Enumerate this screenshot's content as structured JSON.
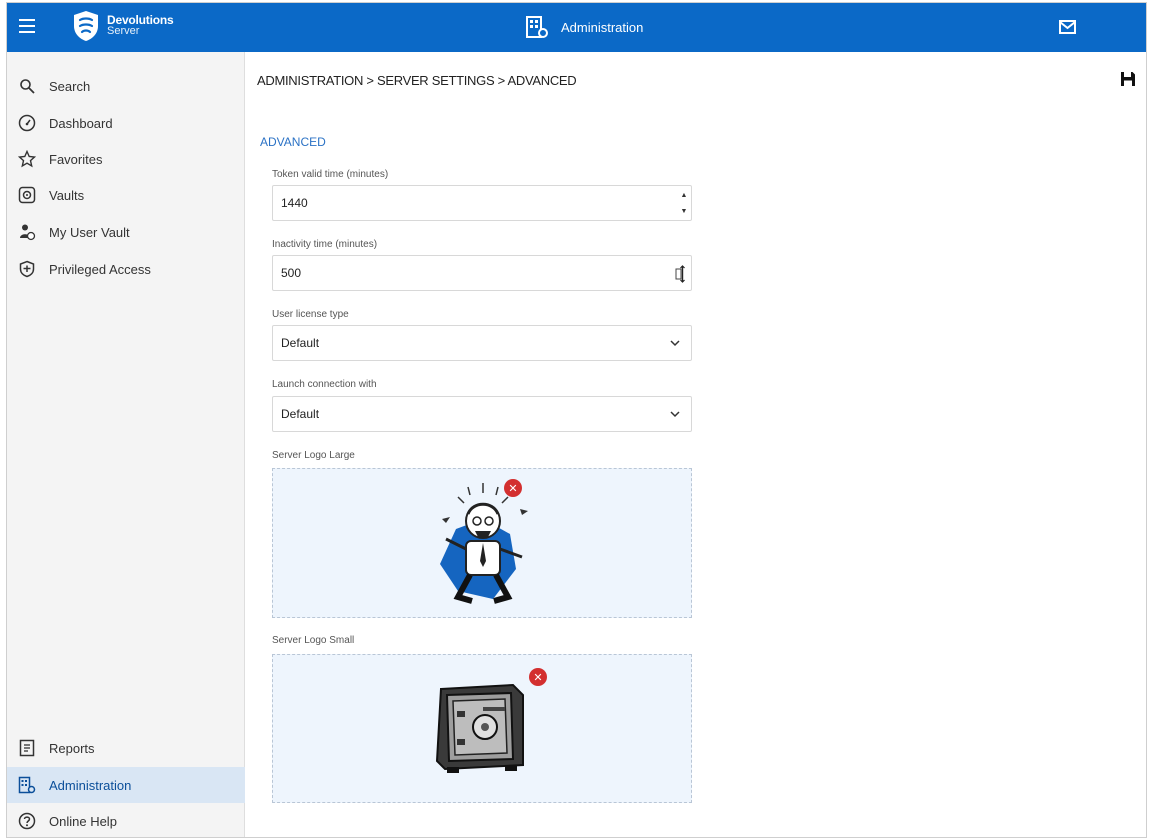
{
  "app": {
    "brand": "Devolutions",
    "product": "Server",
    "title": "Administration"
  },
  "sidebar": {
    "top_items": [
      {
        "label": "Search",
        "icon": "search-icon"
      },
      {
        "label": "Dashboard",
        "icon": "dashboard-icon"
      },
      {
        "label": "Favorites",
        "icon": "star-icon"
      },
      {
        "label": "Vaults",
        "icon": "vault-icon"
      },
      {
        "label": "My User Vault",
        "icon": "user-vault-icon"
      },
      {
        "label": "Privileged Access",
        "icon": "shield-icon"
      }
    ],
    "bottom_items": [
      {
        "label": "Reports",
        "icon": "reports-icon"
      },
      {
        "label": "Administration",
        "icon": "administration-icon",
        "active": true
      },
      {
        "label": "Online Help",
        "icon": "help-icon"
      }
    ]
  },
  "breadcrumb": "ADMINISTRATION  > SERVER SETTINGS  > ADVANCED",
  "section": {
    "title": "ADVANCED"
  },
  "fields": {
    "token_valid_time": {
      "label": "Token valid time (minutes)",
      "value": "1440"
    },
    "inactivity_time": {
      "label": "Inactivity time (minutes)",
      "value": "500"
    },
    "user_license_type": {
      "label": "User license type",
      "value": "Default"
    },
    "launch_connection_with": {
      "label": "Launch connection with",
      "value": "Default"
    },
    "server_logo_large": {
      "label": "Server Logo Large"
    },
    "server_logo_small": {
      "label": "Server Logo Small"
    }
  },
  "colors": {
    "topbar": "#0b69c7",
    "accent": "#2b72c5",
    "remove": "#d32f2f"
  }
}
